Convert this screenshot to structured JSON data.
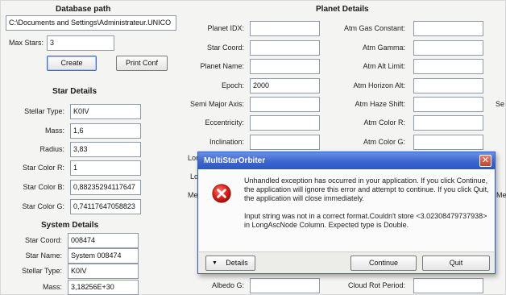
{
  "left": {
    "database_title": "Database path",
    "database_path": "C:\\Documents and Settings\\Administrateur.UNICO",
    "max_stars_label": "Max Stars:",
    "max_stars_value": "3",
    "create_label": "Create",
    "print_label": "Print Conf"
  },
  "star": {
    "title": "Star Details",
    "fields": [
      {
        "label": "Stellar Type:",
        "value": "K0IV"
      },
      {
        "label": "Mass:",
        "value": "1,6"
      },
      {
        "label": "Radius:",
        "value": "3,83"
      },
      {
        "label": "Star Color R:",
        "value": "1"
      },
      {
        "label": "Star Color B:",
        "value": "0,88235294117647"
      },
      {
        "label": "Star Color G:",
        "value": "0,74117647058823"
      }
    ]
  },
  "system": {
    "title": "System Details",
    "fields": [
      {
        "label": "Star Coord:",
        "value": "008474"
      },
      {
        "label": "Star Name:",
        "value": "System 008474"
      },
      {
        "label": "Stellar Type:",
        "value": "K0IV"
      },
      {
        "label": "Mass:",
        "value": "3,18256E+30"
      }
    ]
  },
  "planet": {
    "title": "Planet Details",
    "col1": [
      {
        "label": "Planet IDX:",
        "value": ""
      },
      {
        "label": "Star Coord:",
        "value": ""
      },
      {
        "label": "Planet Name:",
        "value": ""
      },
      {
        "label": "Epoch:",
        "value": "2000"
      },
      {
        "label": "Semi Major Axis:",
        "value": ""
      },
      {
        "label": "Eccentricity:",
        "value": ""
      },
      {
        "label": "Inclination:",
        "value": ""
      }
    ],
    "col1_partial": [
      "Lon",
      "Lo",
      "Me"
    ],
    "albedo_label": "Albedo G:",
    "col2": [
      {
        "label": "Atm Gas Constant:",
        "value": ""
      },
      {
        "label": "Atm Gamma:",
        "value": ""
      },
      {
        "label": "Atm Alt Limit:",
        "value": ""
      },
      {
        "label": "Atm Horizon Alt:",
        "value": ""
      },
      {
        "label": "Atm Haze Shift:",
        "value": ""
      },
      {
        "label": "Atm Color R:",
        "value": ""
      },
      {
        "label": "Atm Color G:",
        "value": ""
      }
    ],
    "cloud_label": "Cloud Rot Period:",
    "right_partial": [
      "Se",
      "Me"
    ]
  },
  "dialog": {
    "title": "MultiStarOrbiter",
    "close_glyph": "✕",
    "message1": "Unhandled exception has occurred in your application. If you click Continue, the application will ignore this error and attempt to continue. If you click Quit, the application will close immediately.",
    "message2": "Input string was not in a correct format.Couldn't store <3.02308479737938> in LongAscNode Column.  Expected type is Double.",
    "details_label": "Details",
    "continue_label": "Continue",
    "quit_label": "Quit"
  }
}
